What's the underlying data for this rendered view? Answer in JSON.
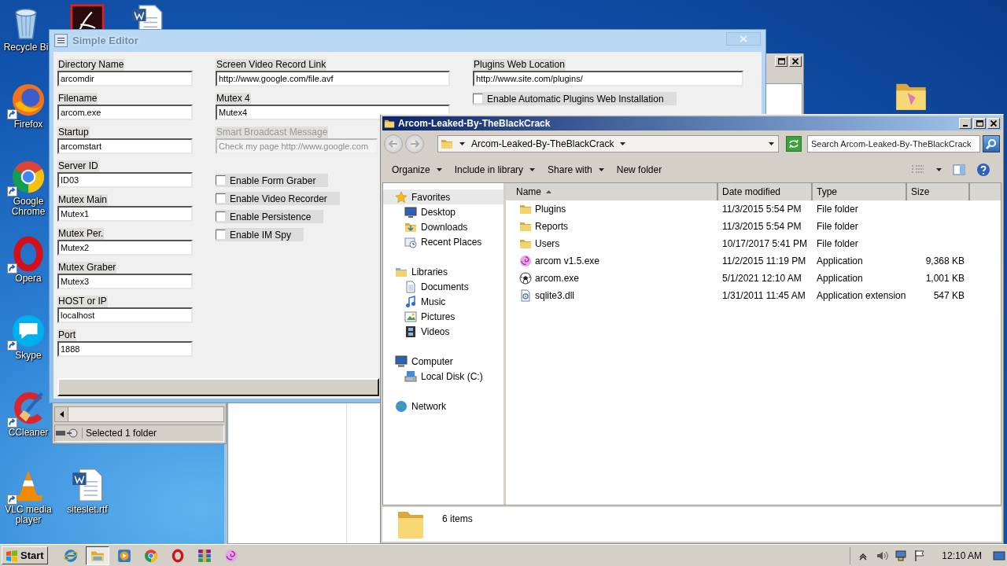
{
  "desktop": {
    "icons": [
      {
        "kind": "recycle",
        "label": "Recycle Bi",
        "shortcut": false
      },
      {
        "kind": "pdf",
        "shortcut": false
      },
      {
        "kind": "word",
        "shortcut": false
      },
      {
        "kind": "firefox",
        "label": "Firefox",
        "shortcut": true
      },
      {
        "kind": "chrome",
        "label": "Google Chrome",
        "shortcut": true
      },
      {
        "kind": "opera",
        "label": "Opera",
        "shortcut": true
      },
      {
        "kind": "skype",
        "label": "Skype",
        "shortcut": true
      },
      {
        "kind": "ccleaner",
        "label": "CCleaner",
        "shortcut": true
      },
      {
        "kind": "vlc",
        "label": "VLC media player",
        "shortcut": true
      },
      {
        "kind": "word",
        "label": "siteslet.rtf",
        "shortcut": false
      },
      {
        "kind": "folder",
        "shortcut": false
      }
    ]
  },
  "back_window": {
    "status": "Selected 1 folder"
  },
  "editor": {
    "title": "Simple Editor",
    "columns": [
      {
        "items": [
          {
            "kind": "field",
            "label": "Directory Name",
            "value": "arcomdir",
            "disabled": false
          },
          {
            "kind": "field",
            "label": "Filename",
            "value": "arcom.exe",
            "disabled": false
          },
          {
            "kind": "field",
            "label": "Startup",
            "value": "arcomstart",
            "disabled": false
          },
          {
            "kind": "field",
            "label": "Server ID",
            "value": "ID03",
            "disabled": false
          },
          {
            "kind": "field",
            "label": "Mutex Main",
            "value": "Mutex1",
            "disabled": false
          },
          {
            "kind": "field",
            "label": "Mutex Per.",
            "value": "Mutex2",
            "disabled": false
          },
          {
            "kind": "field",
            "label": "Mutex Graber",
            "value": "Mutex3",
            "disabled": false
          },
          {
            "kind": "field",
            "label": "HOST or IP",
            "value": "localhost",
            "disabled": false
          },
          {
            "kind": "field",
            "label": "Port",
            "value": "1888",
            "disabled": false
          }
        ]
      },
      {
        "items": [
          {
            "kind": "field",
            "label": "Screen Video Record Link",
            "value": "http://www.google.com/file.avf",
            "disabled": false
          },
          {
            "kind": "field",
            "label": "Mutex 4",
            "value": "Mutex4",
            "disabled": false
          },
          {
            "kind": "field",
            "label": "Smart Broadcast  Message",
            "value": "Check my page http://www.google.com",
            "disabled": true
          },
          {
            "kind": "check",
            "label": "Enable Form Graber",
            "checked": false
          },
          {
            "kind": "check",
            "label": "Enable Video Recorder",
            "checked": false
          },
          {
            "kind": "check",
            "label": "Enable Persistence",
            "checked": false
          },
          {
            "kind": "check",
            "label": "Enable IM Spy",
            "checked": false
          }
        ]
      },
      {
        "items": [
          {
            "kind": "field",
            "label": "Plugins Web Location",
            "value": "http://www.site.com/plugins/",
            "disabled": false
          },
          {
            "kind": "check",
            "label": "Enable Automatic Plugins Web Installation",
            "checked": false
          }
        ]
      }
    ]
  },
  "explorer": {
    "title": "Arcom-Leaked-By-TheBlackCrack",
    "path": "Arcom-Leaked-By-TheBlackCrack",
    "search_placeholder": "Search Arcom-Leaked-By-TheBlackCrack",
    "toolbar": [
      {
        "label": "Organize",
        "menu": true
      },
      {
        "label": "Include in library",
        "menu": true
      },
      {
        "label": "Share with",
        "menu": true
      },
      {
        "label": "New folder",
        "menu": false
      }
    ],
    "nav": [
      {
        "kind": "star",
        "label": "Favorites",
        "selected": true,
        "children": [
          {
            "kind": "desktop",
            "label": "Desktop",
            "selected": false
          },
          {
            "kind": "downloads",
            "label": "Downloads",
            "selected": false
          },
          {
            "kind": "recent",
            "label": "Recent Places",
            "selected": false
          }
        ]
      },
      {
        "kind": "libraries",
        "label": "Libraries",
        "selected": false,
        "children": [
          {
            "kind": "documents",
            "label": "Documents",
            "selected": false
          },
          {
            "kind": "music",
            "label": "Music",
            "selected": false
          },
          {
            "kind": "pictures",
            "label": "Pictures",
            "selected": false
          },
          {
            "kind": "videos",
            "label": "Videos",
            "selected": false
          }
        ]
      },
      {
        "kind": "computer",
        "label": "Computer",
        "selected": false,
        "children": [
          {
            "kind": "disk",
            "label": "Local Disk (C:)",
            "selected": false
          }
        ]
      },
      {
        "kind": "network",
        "label": "Network",
        "selected": false
      }
    ],
    "columns": [
      {
        "label": "Name",
        "sorted": true
      },
      {
        "label": "Date modified",
        "sorted": false
      },
      {
        "label": "Type",
        "sorted": false
      },
      {
        "label": "Size",
        "sorted": false
      }
    ],
    "rows": [
      {
        "kind": "folder",
        "name": "Plugins",
        "date": "11/3/2015 5:54 PM",
        "type": "File folder"
      },
      {
        "kind": "folder",
        "name": "Reports",
        "date": "11/3/2015 5:54 PM",
        "type": "File folder"
      },
      {
        "kind": "folder",
        "name": "Users",
        "date": "10/17/2017 5:41 PM",
        "type": "File folder"
      },
      {
        "kind": "swirl",
        "name": "arcom v1.5.exe",
        "date": "11/2/2015 11:19 PM",
        "type": "Application",
        "size": "9,368 KB"
      },
      {
        "kind": "ball",
        "name": "arcom.exe",
        "date": "5/1/2021 12:10 AM",
        "type": "Application",
        "size": "1,001 KB"
      },
      {
        "kind": "dll",
        "name": "sqlite3.dll",
        "date": "1/31/2011 11:45 AM",
        "type": "Application extension",
        "size": "547 KB"
      }
    ],
    "status": "6 items"
  },
  "taskbar": {
    "start": "Start",
    "items": [
      {
        "kind": "ie",
        "active": false
      },
      {
        "kind": "explorer",
        "active": true
      },
      {
        "kind": "media",
        "active": false
      },
      {
        "kind": "chrome",
        "active": false
      },
      {
        "kind": "opera",
        "active": false
      },
      {
        "kind": "winrar",
        "active": false
      },
      {
        "kind": "swirl",
        "active": false
      }
    ],
    "tray": [
      {
        "kind": "caret"
      },
      {
        "kind": "speaker"
      },
      {
        "kind": "network"
      },
      {
        "kind": "flag"
      }
    ],
    "time": "12:10 AM"
  }
}
